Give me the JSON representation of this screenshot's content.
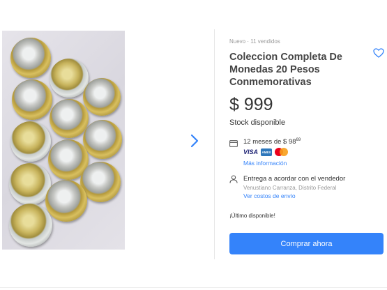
{
  "product": {
    "condition_sold": "Nuevo  ·  11 vendidos",
    "title": "Coleccion Completa De Monedas 20 Pesos Conmemorativas",
    "price": "$ 999",
    "stock": "Stock disponible",
    "installments": {
      "text": "12 meses de $ 98",
      "cents": "69",
      "cards": [
        "VISA",
        "AMERICAN EXPRESS",
        "Mastercard"
      ],
      "more_link": "Más información"
    },
    "shipping": {
      "text": "Entrega a acordar con el vendedor",
      "location": "Venustiano Carranza, Distrito Federal",
      "costs_link": "Ver costos de envío"
    },
    "last_available": "¡Último disponible!",
    "buy_button": "Comprar ahora"
  },
  "icons": {
    "favorite": "heart-outline-icon",
    "next_image": "chevron-right-icon",
    "installments": "credit-card-icon",
    "shipping": "person-icon"
  },
  "colors": {
    "accent": "#3483fa",
    "text": "#333333",
    "muted": "#999999"
  }
}
